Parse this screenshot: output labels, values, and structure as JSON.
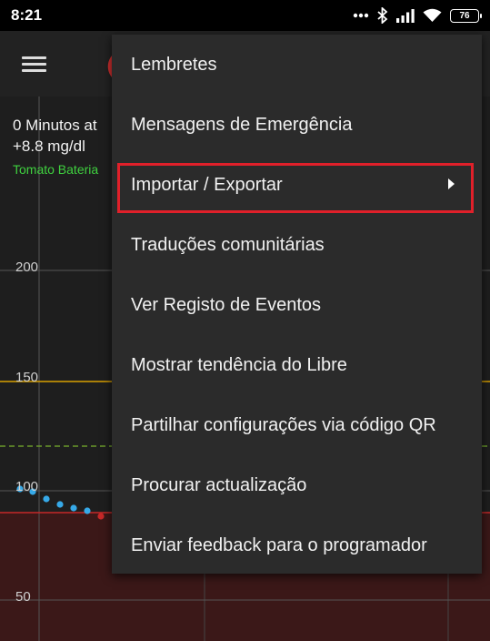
{
  "status_bar": {
    "time": "8:21",
    "icons": [
      "dots-icon",
      "bluetooth-icon",
      "signal-icon",
      "wifi-icon",
      "battery-icon"
    ],
    "battery_level": "76"
  },
  "app_bar": {
    "menu_icon": "hamburger-menu-icon",
    "logo_icon": "xdrip-logo-icon"
  },
  "chart": {
    "info_time": "0 Minutos at",
    "info_delta": "+8.8 mg/dl",
    "info_battery": "Tomato Bateria",
    "y_ticks": [
      "200",
      "150",
      "100",
      "50"
    ],
    "colors": {
      "high_line": "#d9a000",
      "low_line": "#c62828",
      "target_dashed": "#6a9a2a",
      "readings": "#36a9e8",
      "low_fill": "#3b1818"
    }
  },
  "chart_data": {
    "type": "scatter",
    "y_ticks": [
      50,
      100,
      150,
      200
    ],
    "thresholds": {
      "high": 150,
      "low": 88,
      "target": 120
    },
    "series": [
      {
        "values": [
          99,
          98,
          96,
          94,
          93,
          92,
          90
        ]
      }
    ]
  },
  "menu": {
    "items": [
      {
        "label": "Lembretes"
      },
      {
        "label": "Mensagens de Emergência"
      },
      {
        "label": "Importar / Exportar",
        "has_submenu": true,
        "highlighted": true
      },
      {
        "label": "Traduções comunitárias"
      },
      {
        "label": "Ver Registo de Eventos"
      },
      {
        "label": "Mostrar tendência do Libre"
      },
      {
        "label": "Partilhar configurações via código QR"
      },
      {
        "label": "Procurar actualização"
      },
      {
        "label": "Enviar feedback para o programador"
      }
    ],
    "highlight_color": "#e0202a"
  }
}
